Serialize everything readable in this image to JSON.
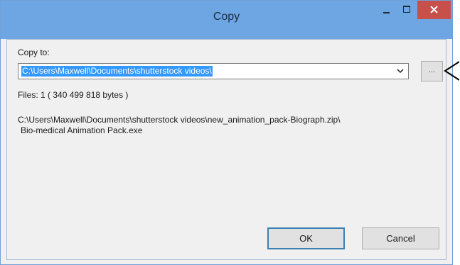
{
  "window": {
    "title": "Copy",
    "accent_color": "#6ea6e4",
    "close_color": "#c7504b"
  },
  "copy_to": {
    "label": "Copy to:",
    "path_value": "C:\\Users\\Maxwell\\Documents\\shutterstock videos\\",
    "browse_label": "..."
  },
  "files": {
    "summary": "Files: 1    ( 340 499 818 bytes )",
    "source_path_line1": "C:\\Users\\Maxwell\\Documents\\shutterstock videos\\new_animation_pack-Biograph.zip\\",
    "source_path_line2": "Bio-medical Animation Pack.exe"
  },
  "buttons": {
    "ok_label": "OK",
    "cancel_label": "Cancel"
  },
  "icons": {
    "minimize": "minimize-icon",
    "maximize": "maximize-icon",
    "close": "close-icon",
    "dropdown": "chevron-down-icon",
    "annotation": "annotation-arrow-icon"
  }
}
